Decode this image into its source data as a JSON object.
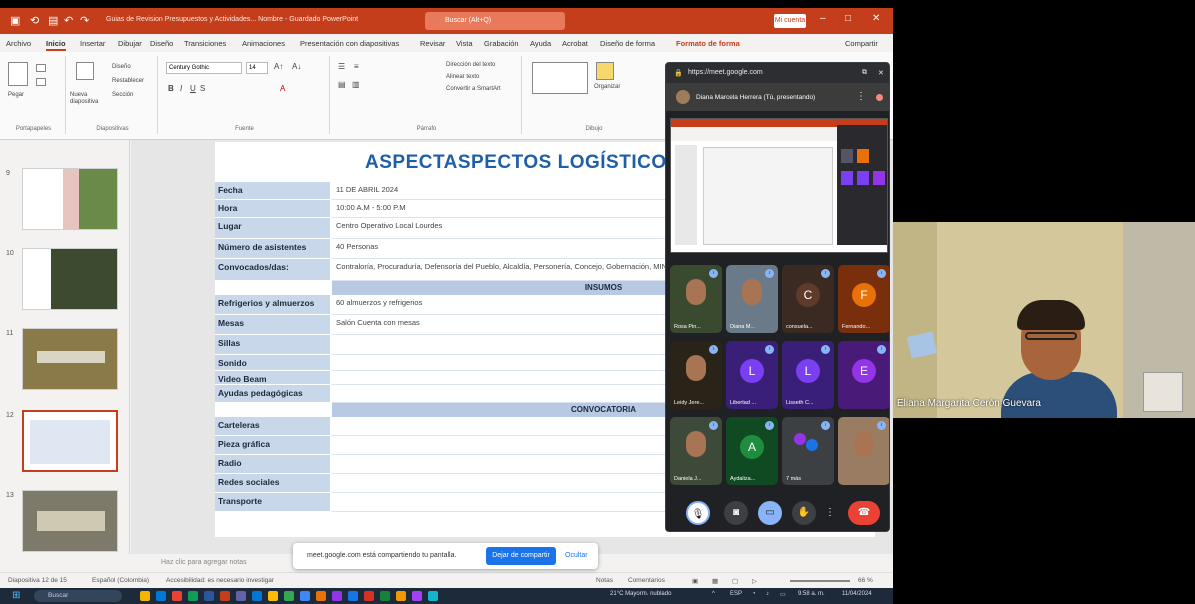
{
  "powerpoint": {
    "title_bar": {
      "document_title": "Guias de Revision Presupuestos y Actividades...  Nombre - Guardado  PowerPoint",
      "search_placeholder": "Buscar (Alt+Q)",
      "user_badge": "Mi cuenta"
    },
    "menu_tabs": [
      "Archivo",
      "Inicio",
      "Insertar",
      "Dibujar",
      "Diseño",
      "Transiciones",
      "Animaciones",
      "Presentación con diapositivas",
      "Revisar",
      "Vista",
      "Grabación",
      "Ayuda",
      "Acrobat",
      "Diseño de forma",
      "Formato de forma"
    ],
    "active_tab": "Inicio",
    "share_label": "Compartir",
    "ribbon": {
      "groups": [
        "Portapapeles",
        "Diapositivas",
        "Fuente",
        "Párrafo",
        "Dibujo"
      ],
      "paste_label": "Pegar",
      "new_slide_label": "Nueva diapositiva",
      "font_name": "Century Gothic",
      "font_size": "14",
      "layout_label": "Diseño",
      "reset_label": "Restablecer",
      "section_label": "Sección",
      "direction_label": "Dirección del texto",
      "align_label": "Alinear texto",
      "smartart_label": "Convertir a SmartArt",
      "arrange_label": "Organizar"
    },
    "thumbnails": [
      {
        "num": "9"
      },
      {
        "num": "10"
      },
      {
        "num": "11"
      },
      {
        "num": "12",
        "selected": true
      },
      {
        "num": "13"
      }
    ],
    "slide": {
      "title": "ASPECTASPECTOS LOGÍSTICOS",
      "rows": [
        {
          "label": "Fecha",
          "value": "11 DE ABRIL 2024"
        },
        {
          "label": "Hora",
          "value": "10:00 A.M - 5:00 P.M"
        },
        {
          "label": "Lugar",
          "value": "Centro Operativo Local Lourdes"
        },
        {
          "label": "Número de asistentes",
          "value": "40  Personas"
        },
        {
          "label": "Convocados/das:",
          "value": "Contraloría, Procuraduría, Defensoría del Pueblo, Alcaldía, Personería, Concejo, Gobernación, MIN AGRICULTURA, SDA, Acueducto de Bogotá, CAR"
        }
      ],
      "section_insumos": "INSUMOS",
      "insumos_rows": [
        {
          "label": "Refrigerios y almuerzos",
          "value": "60 almuerzos y refrigerios"
        },
        {
          "label": "Mesas",
          "value": "Salón Cuenta con mesas"
        },
        {
          "label": "Sillas",
          "value": ""
        },
        {
          "label": "Sonido",
          "value": ""
        },
        {
          "label": "Video Beam",
          "value": ""
        },
        {
          "label": "Ayudas pedagógicas",
          "value": ""
        }
      ],
      "section_convocatoria": "CONVOCATORIA",
      "convocatoria_rows": [
        {
          "label": "Carteleras",
          "value": ""
        },
        {
          "label": "Pieza gráfica",
          "value": ""
        },
        {
          "label": "Radio",
          "value": ""
        },
        {
          "label": "Redes sociales",
          "value": ""
        },
        {
          "label": "Transporte",
          "value": ""
        }
      ]
    },
    "notes_placeholder": "Haz clic para agregar notas",
    "status_bar": {
      "slide_info": "Diapositiva 12 de 15",
      "language": "Español (Colombia)",
      "accessibility": "Accesibilidad: es necesario investigar",
      "notes": "Notas",
      "comments": "Comentarios",
      "zoom": "66 %"
    },
    "share_banner": {
      "message": "meet.google.com está compartiendo tu pantalla.",
      "stop_label": "Dejar de compartir",
      "hide_label": "Ocultar"
    }
  },
  "meet": {
    "url": "https://meet.google.com",
    "presenter_text": "Diana Marcela Herrera (Tú, presentando)",
    "participants": [
      {
        "name": "Rosa Pin...",
        "type": "video",
        "color": "#3a4a2f"
      },
      {
        "name": "Diana M...",
        "type": "video",
        "color": "#6b7a88"
      },
      {
        "name": "consuela...",
        "type": "initial",
        "initial": "C",
        "color": "#5f3b2a",
        "bg": "#3b2a22"
      },
      {
        "name": "Fernando...",
        "type": "initial",
        "initial": "F",
        "color": "#e8710a",
        "bg": "#7a2f0c"
      },
      {
        "name": "Leidy Jere...",
        "type": "video",
        "color": "#2a2418"
      },
      {
        "name": "Libertad ...",
        "type": "initial",
        "initial": "L",
        "color": "#7b3ff2",
        "bg": "#3a1f78"
      },
      {
        "name": "Lisseth C...",
        "type": "initial",
        "initial": "L",
        "color": "#7b3ff2",
        "bg": "#3a1f78"
      },
      {
        "name": "",
        "type": "initial",
        "initial": "E",
        "color": "#9334e6",
        "bg": "#4a1a78"
      },
      {
        "name": "Daniela J...",
        "type": "video",
        "color": "#3d4a3a"
      },
      {
        "name": "Aydaliza...",
        "type": "initial",
        "initial": "A",
        "color": "#1e8e3e",
        "bg": "#0f4a22"
      },
      {
        "name": "7 más",
        "type": "more",
        "color": "#3c4043"
      },
      {
        "name": "",
        "type": "video",
        "color": "#9a7c63"
      }
    ],
    "controls": [
      "mic-icon",
      "camera-icon",
      "present-icon",
      "hand-icon",
      "more-icon",
      "end-call-icon"
    ]
  },
  "camera_feed": {
    "name": "Eliana Margarita Cerón Guevara"
  },
  "taskbar": {
    "search_label": "Buscar",
    "weather": "21°C  Mayorm. nublado",
    "language": "ESP",
    "time": "9:58 a. m.",
    "date": "11/04/2024"
  }
}
